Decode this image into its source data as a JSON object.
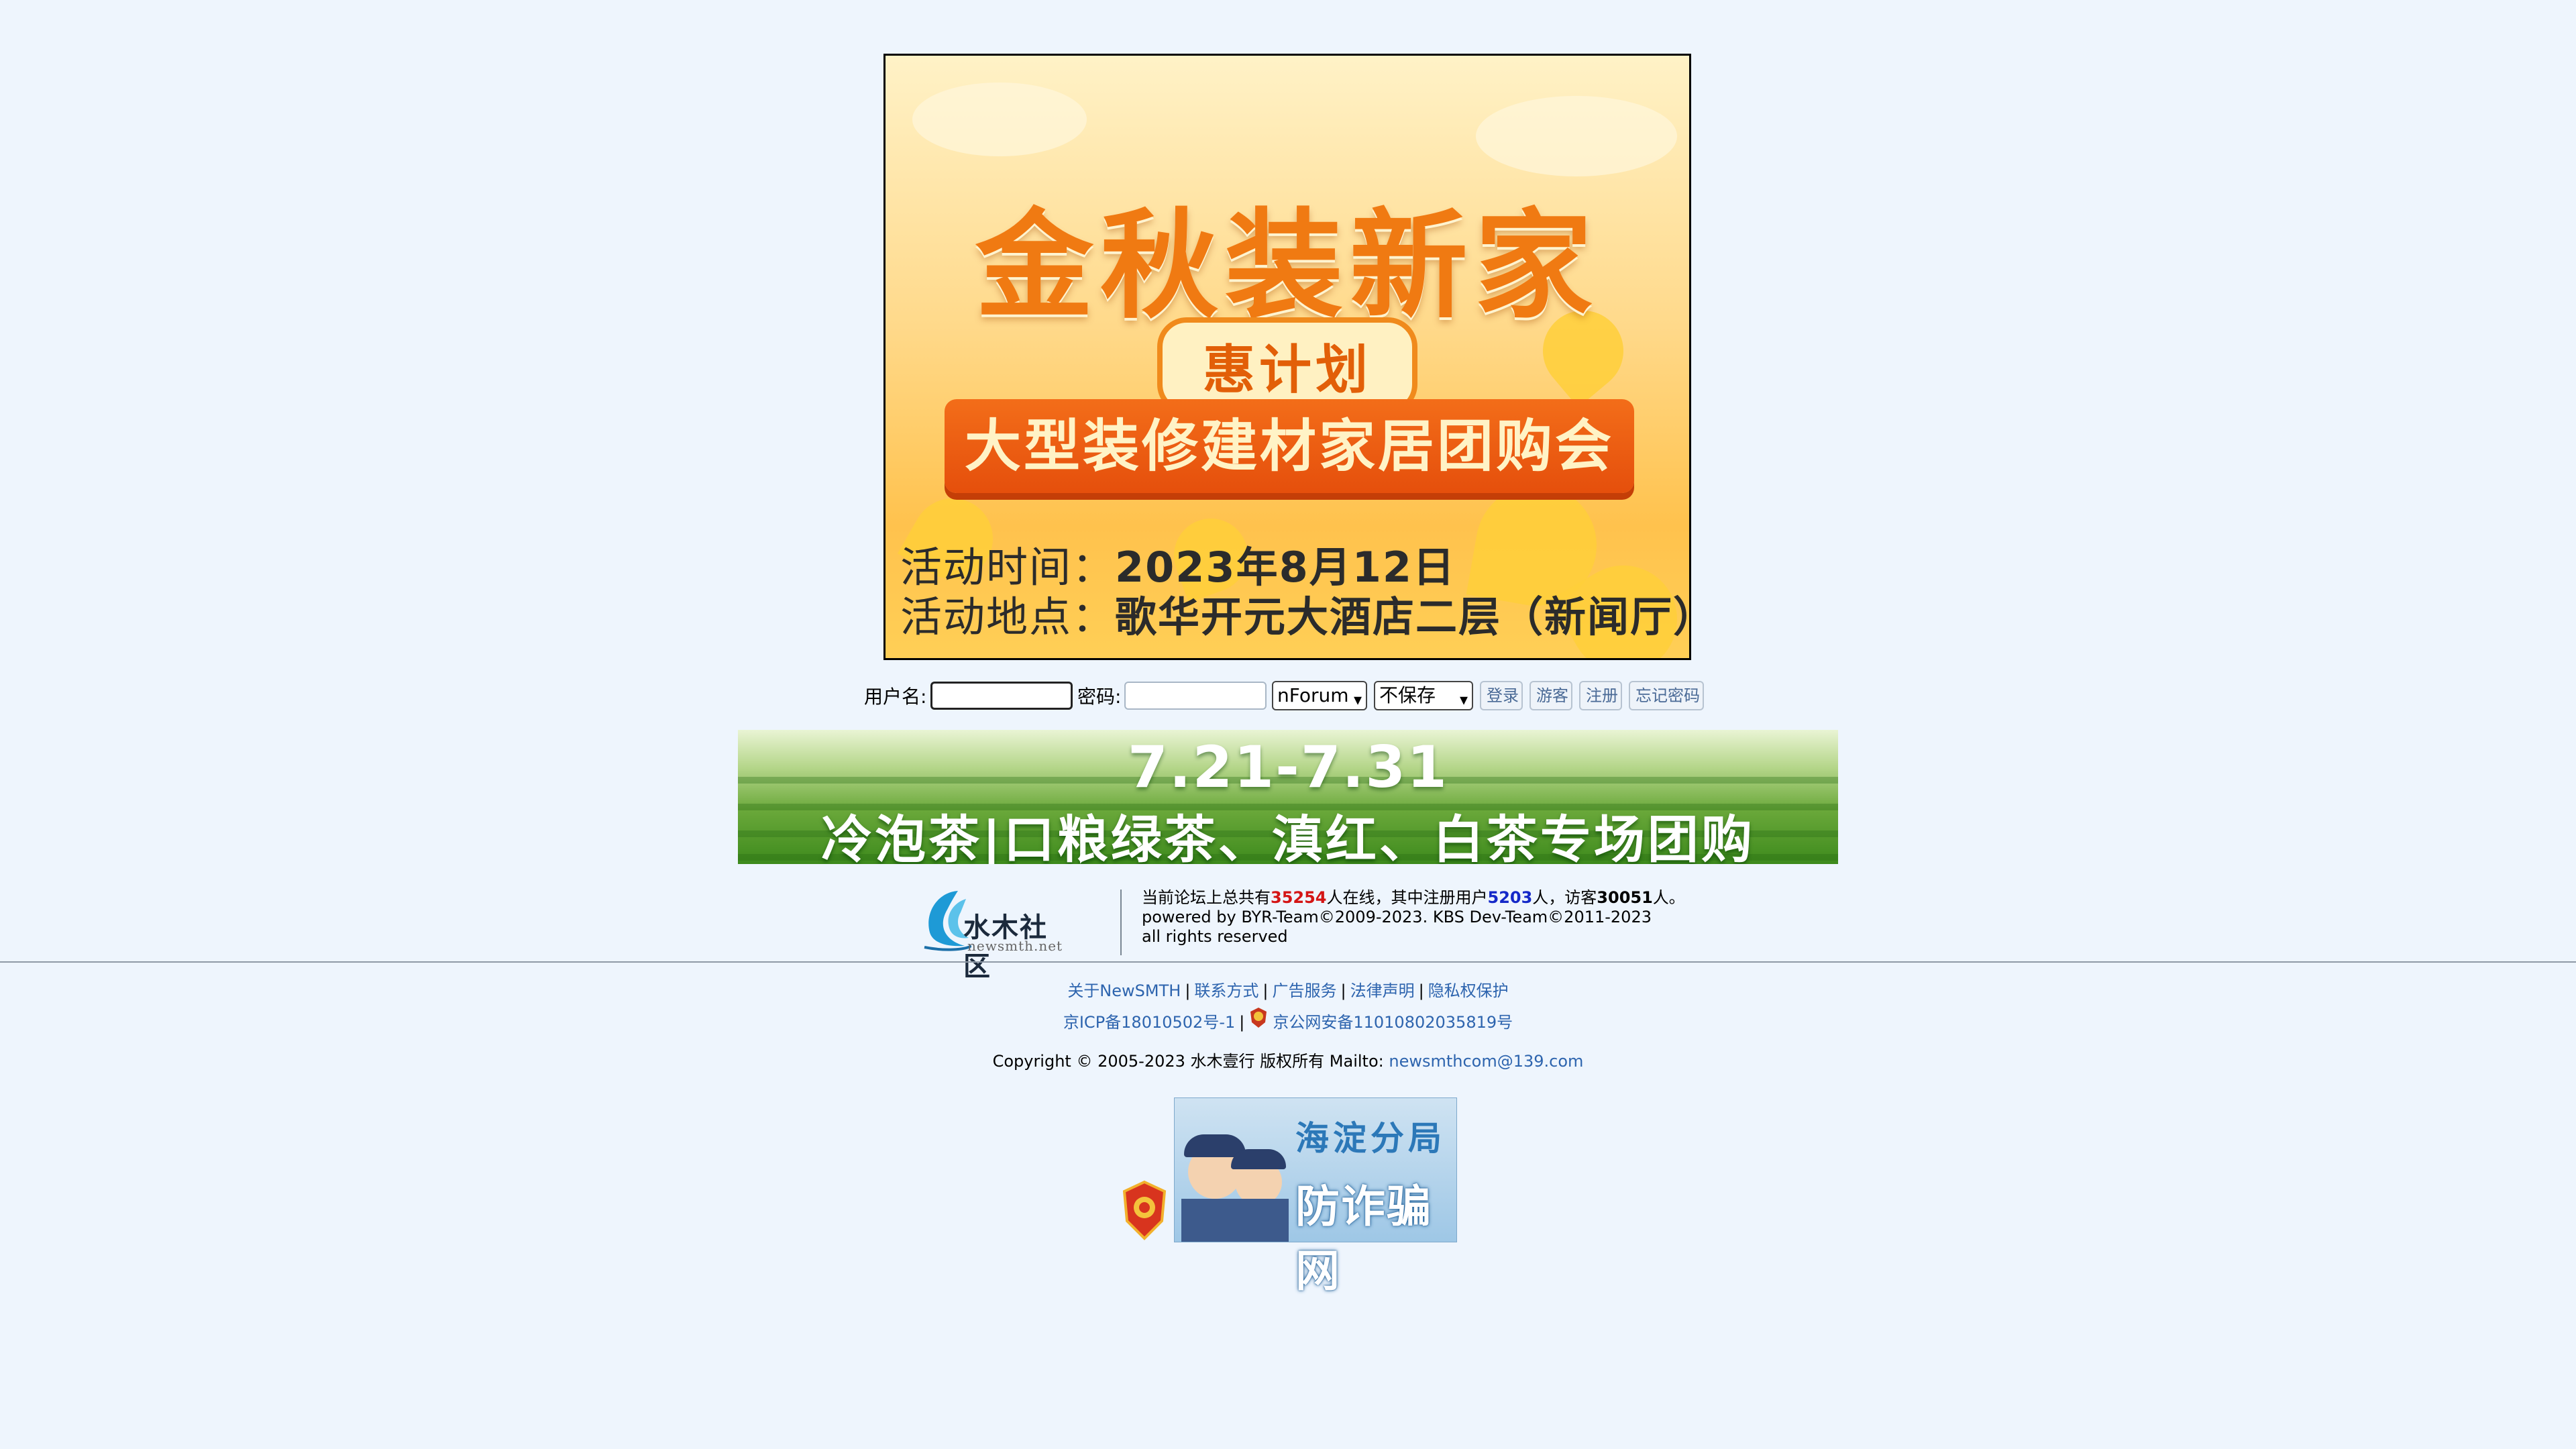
{
  "banner_top": {
    "title": "金秋装新家",
    "subtitle": "惠计划",
    "ribbon": "大型装修建材家居团购会",
    "time_label": "活动时间：",
    "time_value": "2023年8月12日",
    "place_label": "活动地点：",
    "place_value": "歌华开元大酒店二层（新闻厅）"
  },
  "login": {
    "username_label": "用户名:",
    "username_value": "",
    "password_label": "密码:",
    "password_value": "",
    "mode_select": "nForum",
    "save_select": "不保存",
    "login_button": "登录",
    "guest_button": "游客",
    "register_button": "注册",
    "forgot_button": "忘记密码"
  },
  "banner_tea": {
    "date": "7.21-7.31",
    "text": "冷泡茶|口粮绿茶、滇红、白茶专场团购"
  },
  "site": {
    "logo_text": "水木社区",
    "logo_sub": "newsmth.net"
  },
  "stats": {
    "prefix": "当前论坛上总共有",
    "total": "35254",
    "mid1": "人在线，其中注册用户",
    "registered": "5203",
    "mid2": "人，访客",
    "guests": "30051",
    "suffix": "人。",
    "powered": "powered by BYR-Team©2009-2023. KBS Dev-Team©2011-2023",
    "rights": "all rights reserved"
  },
  "footer": {
    "links": [
      "关于NewSMTH",
      "联系方式",
      "广告服务",
      "法律声明",
      "隐私权保护"
    ],
    "icp": "京ICP备18010502号-1",
    "psb": "京公网安备11010802035819号",
    "copyright": "Copyright © 2005-2023 水木壹行 版权所有 Mailto: ",
    "email": "newsmthcom@139.com"
  },
  "antifraud": {
    "line1": "海淀分局",
    "line2": "防诈骗网"
  },
  "colors": {
    "page_bg": "#eef5fd",
    "link": "#2d64ae",
    "stat_total": "#d41414",
    "stat_registered": "#1428c8"
  }
}
